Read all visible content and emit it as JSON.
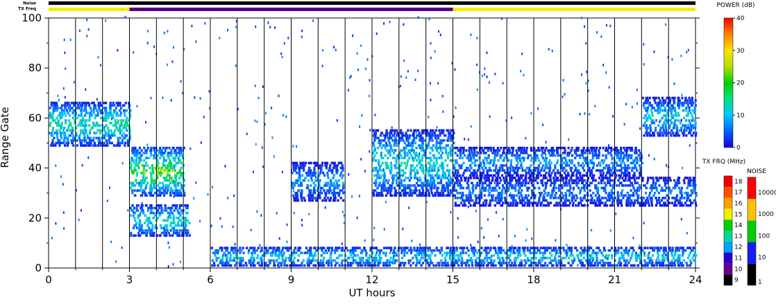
{
  "chart_data": {
    "type": "heatmap",
    "title": "",
    "xlabel": "UT hours",
    "ylabel": "Range Gate",
    "xlim": [
      0,
      24
    ],
    "ylim": [
      0,
      100
    ],
    "x_ticks": [
      "0",
      "3",
      "6",
      "9",
      "12",
      "15",
      "18",
      "21",
      "24"
    ],
    "y_ticks": [
      "0",
      "20",
      "40",
      "60",
      "80",
      "100"
    ],
    "status_bars": {
      "noise_label": "Noise",
      "txfreq_label": "TX Freq",
      "noise_color": "#000000",
      "txfreq_segments": [
        {
          "start": 0,
          "end": 3,
          "color": "#f0f000"
        },
        {
          "start": 3,
          "end": 15,
          "color": "#550088"
        },
        {
          "start": 15,
          "end": 24,
          "color": "#f0f000"
        }
      ]
    },
    "scan_boundaries_ut": [
      1,
      2,
      3,
      4,
      5,
      6,
      7,
      8,
      9,
      10,
      11,
      12,
      13,
      14,
      15,
      16,
      17,
      18,
      19,
      20,
      21,
      22,
      23
    ],
    "echo_regions": [
      {
        "label": "band near gate 57",
        "x_start": 0.0,
        "x_end": 3.0,
        "gate_start": 48,
        "gate_end": 66,
        "peak_db": 18
      },
      {
        "label": "band near gate 38",
        "x_start": 3.0,
        "x_end": 5.0,
        "gate_start": 28,
        "gate_end": 48,
        "peak_db": 25
      },
      {
        "label": "band near gate 18",
        "x_start": 3.0,
        "x_end": 5.2,
        "gate_start": 12,
        "gate_end": 25,
        "peak_db": 16
      },
      {
        "label": "cluster near gate 34",
        "x_start": 9.0,
        "x_end": 10.9,
        "gate_start": 26,
        "gate_end": 42,
        "peak_db": 10
      },
      {
        "label": "band gate 46 to 30",
        "x_start": 12.0,
        "x_end": 15.0,
        "gate_start": 28,
        "gate_end": 55,
        "peak_db": 16
      },
      {
        "label": "band gate 45 to 40",
        "x_start": 15.0,
        "x_end": 22.0,
        "gate_start": 36,
        "gate_end": 48,
        "peak_db": 10
      },
      {
        "label": "band gate 30",
        "x_start": 15.0,
        "x_end": 24.0,
        "gate_start": 24,
        "gate_end": 36,
        "peak_db": 8
      },
      {
        "label": "band gate 58",
        "x_start": 22.0,
        "x_end": 24.0,
        "gate_start": 52,
        "gate_end": 68,
        "peak_db": 14
      },
      {
        "label": "ground band",
        "x_start": 6.0,
        "x_end": 24.0,
        "gate_start": 0,
        "gate_end": 8,
        "peak_db": 14
      }
    ],
    "colorbars": {
      "power": {
        "title": "POWER (dB)",
        "range": [
          0,
          40
        ],
        "ticks": [
          "0",
          "10",
          "20",
          "30",
          "40"
        ],
        "stops": [
          "#1a00d8",
          "#0060ff",
          "#00c8ff",
          "#00e080",
          "#00d000",
          "#b0e000",
          "#ffe000",
          "#ff8000",
          "#ff0000"
        ]
      },
      "tx_freq": {
        "title": "TX FRQ (MHz)",
        "labels": [
          "9",
          "10",
          "11",
          "12",
          "13",
          "14",
          "15",
          "16",
          "17",
          "18"
        ],
        "colors": [
          "#000000",
          "#6a0090",
          "#2a00d0",
          "#00a0ff",
          "#00d8a0",
          "#00d000",
          "#f0f000",
          "#ffa000",
          "#ff5000",
          "#ee0000"
        ]
      },
      "noise": {
        "title": "NOISE",
        "labels": [
          "1",
          "10",
          "100",
          "1000",
          "10000"
        ],
        "colors": [
          "#000000",
          "#1a1aff",
          "#00cc00",
          "#ffc000",
          "#ff0000"
        ]
      }
    }
  }
}
